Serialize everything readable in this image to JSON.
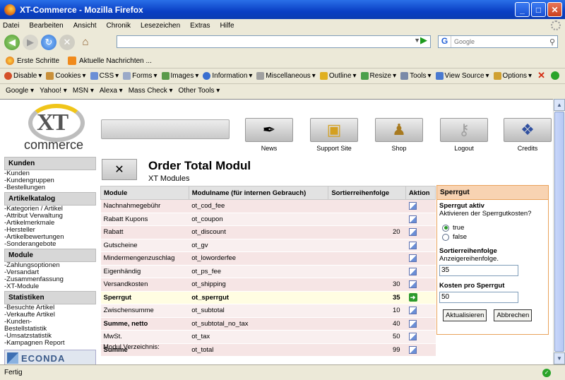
{
  "window": {
    "title": "XT-Commerce - Mozilla Firefox"
  },
  "menu": [
    "Datei",
    "Bearbeiten",
    "Ansicht",
    "Chronik",
    "Lesezeichen",
    "Extras",
    "Hilfe"
  ],
  "search": {
    "engine": "G",
    "placeholder": "Google"
  },
  "bookmarks": [
    "Erste Schritte",
    "Aktuelle Nachrichten ..."
  ],
  "devtoolbar": [
    "Disable",
    "Cookies",
    "CSS",
    "Forms",
    "Images",
    "Information",
    "Miscellaneous",
    "Outline",
    "Resize",
    "Tools",
    "View Source",
    "Options"
  ],
  "googlebar": [
    "Google",
    "Yahoo!",
    "MSN",
    "Alexa",
    "Mass Check",
    "Other Tools"
  ],
  "status": "Fertig",
  "site": {
    "logo_brand": "commerce",
    "logo_mark": "XT",
    "topnav": [
      "News",
      "Support Site",
      "Shop",
      "Logout",
      "Credits"
    ]
  },
  "sidebar": [
    {
      "heading": "Kunden",
      "items": [
        "-Kunden",
        "-Kundengruppen",
        "-Bestellungen"
      ]
    },
    {
      "heading": "Artikelkatalog",
      "items": [
        "-Kategorien / Artikel",
        "-Attribut Verwaltung",
        "-Artikelmerkmale",
        "-Hersteller",
        "-Artikelbewertungen",
        "-Sonderangebote"
      ]
    },
    {
      "heading": "Module",
      "items": [
        "-Zahlungsoptionen",
        "-Versandart",
        "-Zusammenfassung",
        "-XT-Module"
      ]
    },
    {
      "heading": "Statistiken",
      "items": [
        "-Besuchte Artikel",
        "-Verkaufte Artikel",
        "-Kunden-",
        "Bestellstatistik",
        "-Umsatzstatistik",
        "-Kampagnen Report"
      ]
    }
  ],
  "econda": "ECONDA",
  "page": {
    "title": "Order Total Modul",
    "subtitle": "XT Modules"
  },
  "table": {
    "headers": [
      "Module",
      "Modulname (für internen Gebrauch)",
      "Sortierreihenfolge",
      "Aktion"
    ],
    "rows": [
      {
        "module": "Nachnahmegebühr",
        "name": "ot_cod_fee",
        "sort": ""
      },
      {
        "module": "Rabatt Kupons",
        "name": "ot_coupon",
        "sort": ""
      },
      {
        "module": "Rabatt",
        "name": "ot_discount",
        "sort": "20"
      },
      {
        "module": "Gutscheine",
        "name": "ot_gv",
        "sort": ""
      },
      {
        "module": "Mindermengenzuschlag",
        "name": "ot_loworderfee",
        "sort": ""
      },
      {
        "module": "Eigenhändig",
        "name": "ot_ps_fee",
        "sort": ""
      },
      {
        "module": "Versandkosten",
        "name": "ot_shipping",
        "sort": "30"
      },
      {
        "module": "Sperrgut",
        "name": "ot_sperrgut",
        "sort": "35"
      },
      {
        "module": "Zwischensumme",
        "name": "ot_subtotal",
        "sort": "10"
      },
      {
        "module": "Summe, netto",
        "name": "ot_subtotal_no_tax",
        "sort": "40"
      },
      {
        "module": "MwSt.",
        "name": "ot_tax",
        "sort": "50"
      },
      {
        "module": "Summe",
        "name": "ot_total",
        "sort": "99"
      }
    ],
    "footer": "Modul Verzeichnis:"
  },
  "panel": {
    "title": "Sperrgut",
    "aktiv_label": "Sperrgut aktiv",
    "aktiv_desc": "Aktivieren der Sperrgutkosten?",
    "opt_true": "true",
    "opt_false": "false",
    "sort_label": "Sortierreihenfolge",
    "sort_desc": "Anzeigereihenfolge.",
    "sort_value": "35",
    "cost_label": "Kosten pro Sperrgut",
    "cost_value": "50",
    "btn_update": "Aktualisieren",
    "btn_cancel": "Abbrechen"
  }
}
